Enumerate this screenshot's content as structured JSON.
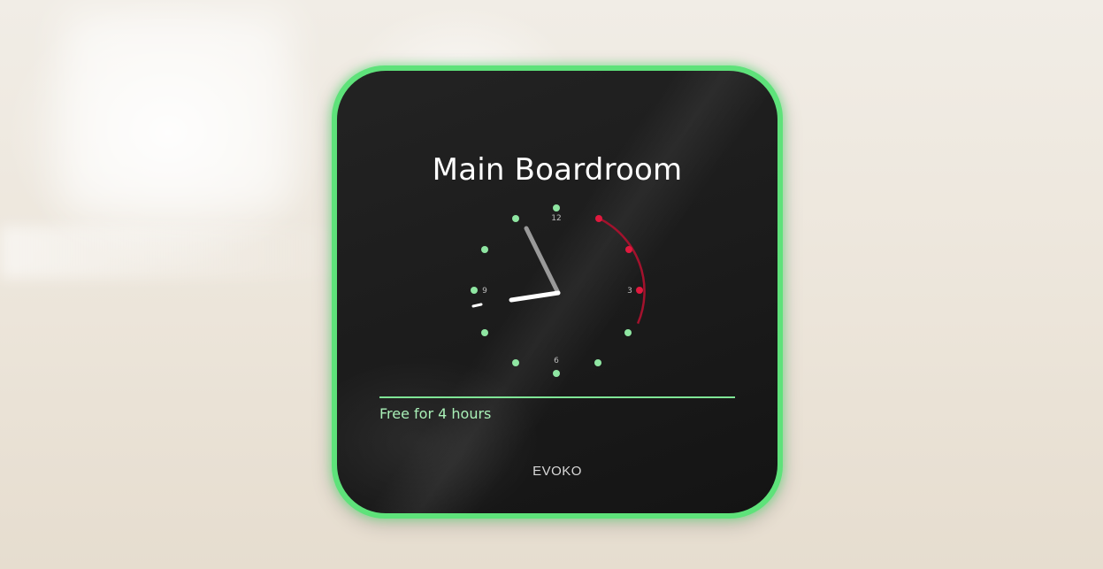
{
  "room": {
    "name": "Main Boardroom"
  },
  "clock": {
    "labels": {
      "twelve": "12",
      "three": "3",
      "six": "6",
      "nine": "9"
    }
  },
  "status": {
    "text": "Free for 4 hours",
    "color": "#a9f0b7"
  },
  "brand": {
    "name": "EVOKO"
  },
  "colors": {
    "frame": "#5ee27a",
    "free_dot": "#8fe6a2",
    "booked": "#e0193e",
    "screen": "#1b1b1b"
  }
}
